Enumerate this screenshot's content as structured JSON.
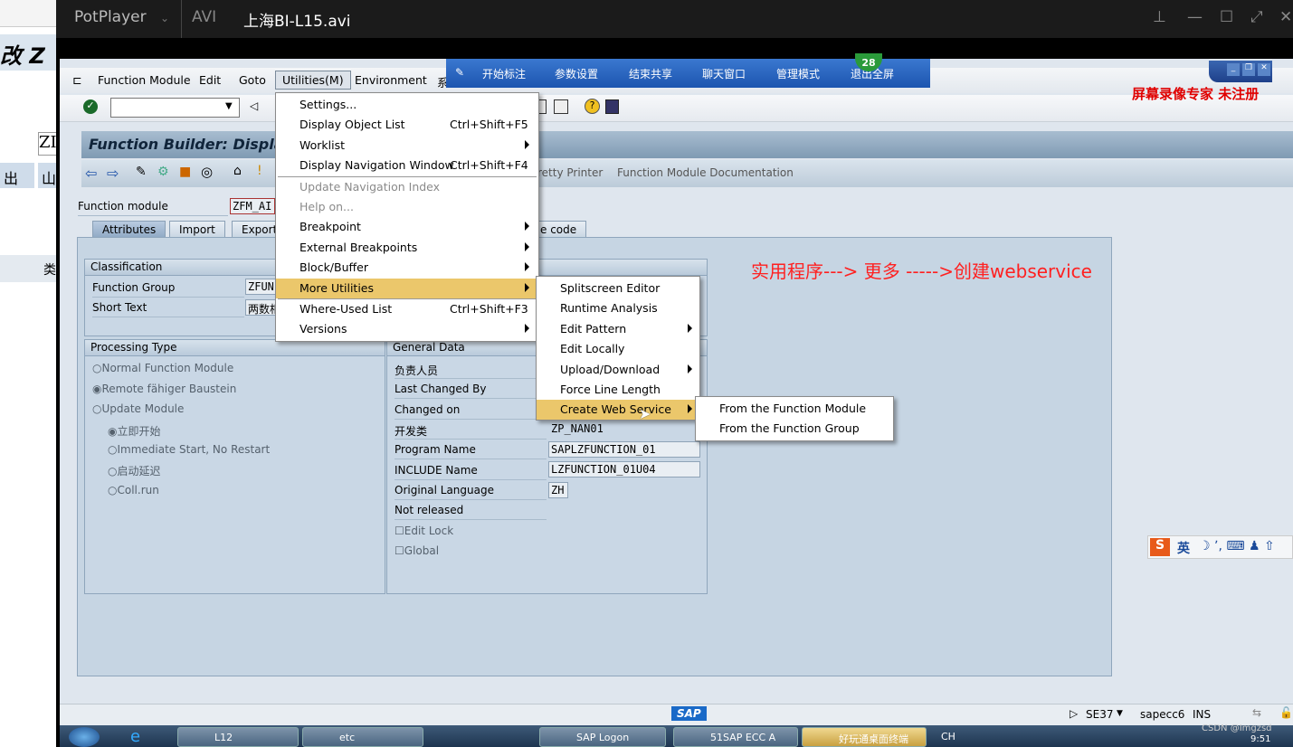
{
  "player": {
    "name": "PotPlayer",
    "format": "AVI",
    "file": "上海BI-L15.avi"
  },
  "background_window": {
    "title_fragment": "改 Z",
    "field_fragment": "ZI",
    "tab1": "出",
    "tab2": "山",
    "col": "类"
  },
  "menubar": {
    "items": [
      "Function Module",
      "Edit",
      "Goto",
      "Utilities(M)",
      "Environment",
      "系"
    ]
  },
  "toolbar": {
    "command_value": ""
  },
  "screen_title": "Function Builder: Displa",
  "app_toolbar": {
    "items": [
      "retty Printer",
      "Function Module Documentation"
    ]
  },
  "function_module": {
    "label": "Function module",
    "value": "ZFM_AI"
  },
  "tabs": [
    "Attributes",
    "Import",
    "Export",
    "e code"
  ],
  "classification": {
    "header": "Classification",
    "rows": [
      {
        "label": "Function Group",
        "value": "ZFUN"
      },
      {
        "label": "Short Text",
        "value": "两数相"
      }
    ]
  },
  "processing_type": {
    "header": "Processing Type",
    "options": [
      {
        "label": "Normal Function Module",
        "selected": false
      },
      {
        "label": "Remote fähiger Baustein",
        "selected": true
      },
      {
        "label": "Update Module",
        "selected": false
      }
    ],
    "sub_options": [
      {
        "label": "立即开始",
        "selected": true
      },
      {
        "label": "Immediate Start, No Restart",
        "selected": false
      },
      {
        "label": "启动延迟",
        "selected": false
      },
      {
        "label": "Coll.run",
        "selected": false
      }
    ]
  },
  "general_data": {
    "header": "General Data",
    "rows": [
      {
        "label": "负责人员",
        "value": ""
      },
      {
        "label": "Last Changed By",
        "value": ""
      },
      {
        "label": "Changed on",
        "value": ""
      },
      {
        "label": "开发类",
        "value": "ZP_NAN01"
      },
      {
        "label": "Program Name",
        "value": "SAPLZFUNCTION_01"
      },
      {
        "label": "INCLUDE Name",
        "value": "LZFUNCTION_01U04"
      },
      {
        "label": "Original Language",
        "value": "ZH"
      },
      {
        "label": "Not released",
        "value": ""
      }
    ],
    "checkboxes": [
      {
        "label": "Edit Lock",
        "checked": false
      },
      {
        "label": "Global",
        "checked": false
      }
    ]
  },
  "utilities_menu": [
    {
      "label": "Settings...",
      "shortcut": "",
      "submenu": false,
      "disabled": false
    },
    {
      "label": "Display Object List",
      "shortcut": "Ctrl+Shift+F5",
      "submenu": false,
      "disabled": false
    },
    {
      "label": "Worklist",
      "shortcut": "",
      "submenu": true,
      "disabled": false
    },
    {
      "label": "Display Navigation Window",
      "shortcut": "Ctrl+Shift+F4",
      "submenu": false,
      "disabled": false
    },
    {
      "label": "Update Navigation Index",
      "shortcut": "",
      "submenu": false,
      "disabled": true
    },
    {
      "label": "Help on...",
      "shortcut": "",
      "submenu": false,
      "disabled": true
    },
    {
      "label": "Breakpoint",
      "shortcut": "",
      "submenu": true,
      "disabled": false
    },
    {
      "label": "External Breakpoints",
      "shortcut": "",
      "submenu": true,
      "disabled": false
    },
    {
      "label": "Block/Buffer",
      "shortcut": "",
      "submenu": true,
      "disabled": false
    },
    {
      "label": "More Utilities",
      "shortcut": "",
      "submenu": true,
      "disabled": false,
      "highlighted": true
    },
    {
      "label": "Where-Used List",
      "shortcut": "Ctrl+Shift+F3",
      "submenu": false,
      "disabled": false
    },
    {
      "label": "Versions",
      "shortcut": "",
      "submenu": true,
      "disabled": false
    }
  ],
  "more_utilities_menu": [
    {
      "label": "Splitscreen Editor",
      "submenu": false
    },
    {
      "label": "Runtime Analysis",
      "submenu": false
    },
    {
      "label": "Edit Pattern",
      "submenu": true
    },
    {
      "label": "Edit Locally",
      "submenu": false
    },
    {
      "label": "Upload/Download",
      "submenu": true
    },
    {
      "label": "Force Line Length",
      "submenu": false
    },
    {
      "label": "Create Web Service",
      "submenu": true,
      "highlighted": true
    }
  ],
  "web_service_menu": [
    "From the Function Module",
    "From the Function Group"
  ],
  "annotation": "实用程序---> 更多 ----->创建webservice",
  "watermark": "屏幕录像专家 未注册",
  "share_toolbar": {
    "items": [
      "开始标注",
      "参数设置",
      "结束共享",
      "聊天窗口",
      "管理模式",
      "退出全屏"
    ],
    "badge": "28"
  },
  "status_bar": {
    "logo": "SAP",
    "transaction": "SE37",
    "server": "sapecc6",
    "mode": "INS"
  },
  "taskbar": {
    "buttons": [
      "L12",
      "etc",
      "SAP Logon",
      "51SAP ECC A",
      "好玩通桌面终端"
    ],
    "tray": "CH",
    "clock": "9:51",
    "credit": "CSDN @Imgzsd"
  },
  "ime": {
    "label": "英"
  },
  "colors": {
    "menu_highlight": "#ebc76b",
    "annotation": "#ff2020",
    "watermark": "#e00000",
    "share_bar": "#2a66c0"
  }
}
